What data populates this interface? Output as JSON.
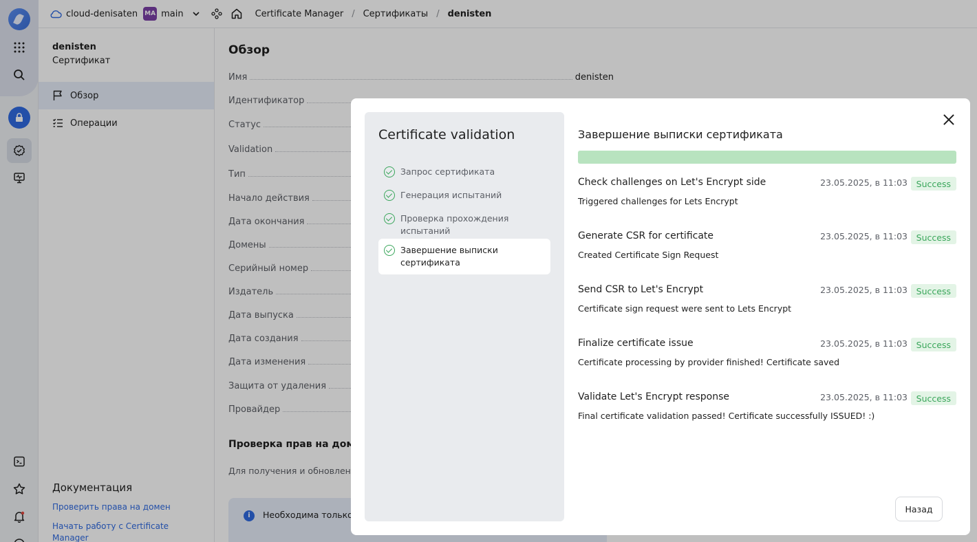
{
  "topbar": {
    "cloud": "cloud-denisaten",
    "folder_badge": "MA",
    "folder": "main",
    "breadcrumb_service": "Certificate Manager",
    "breadcrumb_section": "Сертификаты",
    "breadcrumb_current": "denisten"
  },
  "sidebar": {
    "resource_name": "denisten",
    "resource_type": "Сертификат",
    "items": [
      {
        "label": "Обзор",
        "icon": "flag-icon"
      },
      {
        "label": "Операции",
        "icon": "list-icon"
      }
    ],
    "docs_title": "Документация",
    "docs_links": [
      "Проверить права на домен",
      "Начать работу с Certificate Manager"
    ]
  },
  "main": {
    "title": "Обзор",
    "properties": [
      {
        "label": "Имя",
        "value": "denisten"
      },
      {
        "label": "Идентификатор",
        "value": ""
      },
      {
        "label": "Статус",
        "value": ""
      },
      {
        "label": "Validation",
        "value": ""
      },
      {
        "label": "Тип",
        "value": ""
      },
      {
        "label": "Начало действия",
        "value": ""
      },
      {
        "label": "Дата окончания",
        "value": ""
      },
      {
        "label": "Домены",
        "value": ""
      },
      {
        "label": "Серийный номер",
        "value": ""
      },
      {
        "label": "Издатель",
        "value": ""
      },
      {
        "label": "Дата выпуска",
        "value": ""
      },
      {
        "label": "Дата создания",
        "value": ""
      },
      {
        "label": "Дата изменения",
        "value": ""
      },
      {
        "label": "Защита от удаления",
        "value": ""
      },
      {
        "label": "Провайдер",
        "value": ""
      }
    ],
    "domain_check_title": "Проверка прав на домен",
    "domain_check_text": "Для получения и обновления ... прав на каждый домен, указа...",
    "info_text": "Необходима только о... сразу двух типов."
  },
  "modal": {
    "steps_title": "Certificate validation",
    "steps": [
      {
        "label": "Запрос сертификата",
        "active": false
      },
      {
        "label": "Генерация испытаний",
        "active": false
      },
      {
        "label": "Проверка прохождения испытаний",
        "active": false
      },
      {
        "label": "Завершение выписки сертификата",
        "active": true
      }
    ],
    "detail_title": "Завершение выписки сертификата",
    "entries": [
      {
        "title": "Check challenges on Let's Encrypt side",
        "date": "23.05.2025, в 11:03",
        "status": "Success",
        "description": "Triggered challenges for Lets Encrypt"
      },
      {
        "title": "Generate CSR for certificate",
        "date": "23.05.2025, в 11:03",
        "status": "Success",
        "description": "Created Certificate Sign Request"
      },
      {
        "title": "Send CSR to Let's Encrypt",
        "date": "23.05.2025, в 11:03",
        "status": "Success",
        "description": "Certificate sign request were sent to Lets Encrypt"
      },
      {
        "title": "Finalize certificate issue",
        "date": "23.05.2025, в 11:03",
        "status": "Success",
        "description": "Certificate processing by provider finished! Certificate saved"
      },
      {
        "title": "Validate Let's Encrypt response",
        "date": "23.05.2025, в 11:03",
        "status": "Success",
        "description": "Final certificate validation passed! Certificate successfully ISSUED! :)"
      }
    ],
    "back_label": "Назад",
    "progress_percent": 100
  },
  "colors": {
    "accent": "#2f6ae0",
    "success": "#3aa65b",
    "success_bg": "#e3f4e6",
    "progress": "#b8e3bf"
  }
}
